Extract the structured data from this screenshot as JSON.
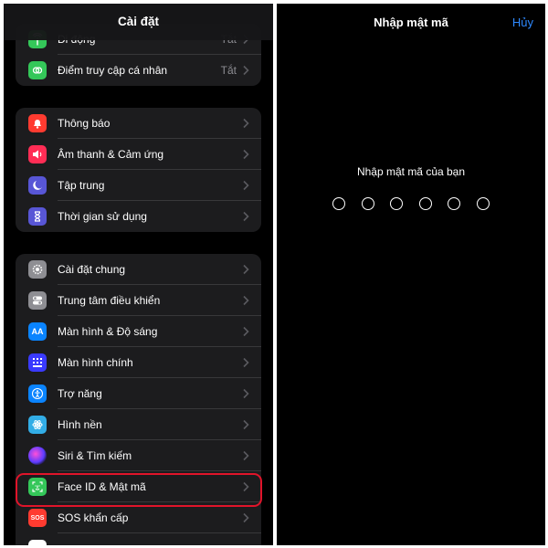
{
  "settings": {
    "title": "Cài đặt",
    "group1": [
      {
        "label": "Di động",
        "value": "Tắt",
        "icon": "antenna-icon",
        "color": "#34c759"
      },
      {
        "label": "Điểm truy cập cá nhân",
        "value": "Tắt",
        "icon": "hotspot-icon",
        "color": "#34c759"
      }
    ],
    "group2": [
      {
        "label": "Thông báo",
        "icon": "bell-icon",
        "color": "#ff3b30"
      },
      {
        "label": "Âm thanh & Cảm ứng",
        "icon": "speaker-icon",
        "color": "#ff2d55"
      },
      {
        "label": "Tập trung",
        "icon": "moon-icon",
        "color": "#5856d6"
      },
      {
        "label": "Thời gian sử dụng",
        "icon": "hourglass-icon",
        "color": "#5856d6"
      }
    ],
    "group3": [
      {
        "label": "Cài đặt chung",
        "icon": "gear-icon",
        "color": "#8e8e93"
      },
      {
        "label": "Trung tâm điều khiển",
        "icon": "toggles-icon",
        "color": "#8e8e93"
      },
      {
        "label": "Màn hình & Độ sáng",
        "icon": "text-size-icon",
        "icon_text": "AA",
        "color": "#0a84ff"
      },
      {
        "label": "Màn hình chính",
        "icon": "home-grid-icon",
        "color": "#3a3aff"
      },
      {
        "label": "Trợ năng",
        "icon": "accessibility-icon",
        "color": "#0a84ff"
      },
      {
        "label": "Hình nền",
        "icon": "flower-icon",
        "color": "#32ade6"
      },
      {
        "label": "Siri & Tìm kiếm",
        "icon": "siri-icon",
        "color": "#1c1c1e"
      },
      {
        "label": "Face ID & Mật mã",
        "icon": "faceid-icon",
        "color": "#34c759"
      },
      {
        "label": "SOS khẩn cấp",
        "icon": "sos-icon",
        "icon_text": "SOS",
        "color": "#ff3b30"
      }
    ]
  },
  "passcode": {
    "title": "Nhập mật mã",
    "cancel_label": "Hủy",
    "prompt": "Nhập mật mã của bạn",
    "digit_count": 6,
    "digits_entered": 0,
    "accent_color": "#2e89ff"
  },
  "highlight_color": "#e0142a"
}
